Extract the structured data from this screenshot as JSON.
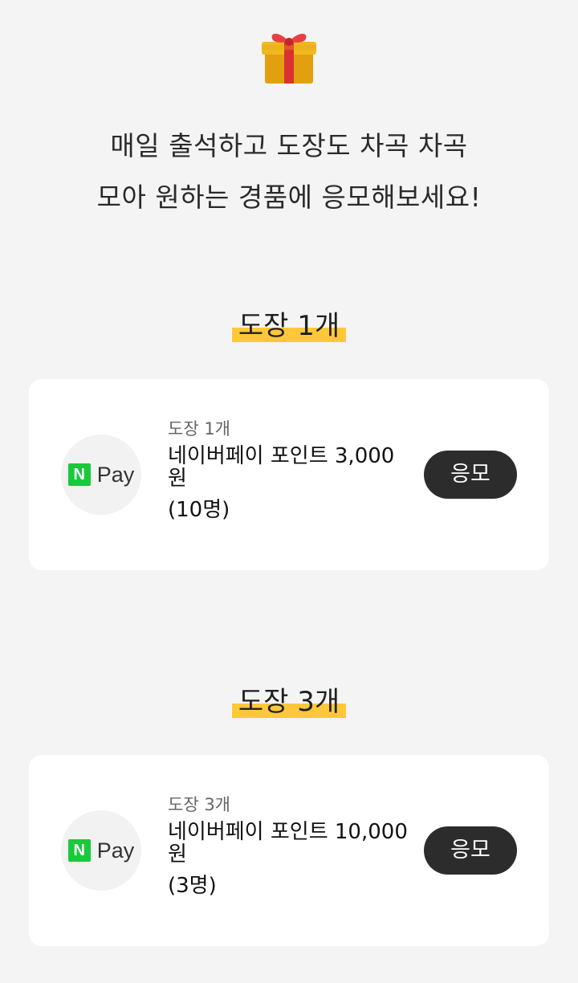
{
  "header": {
    "icon": "gift-icon",
    "line1": "매일 출석하고 도장도 차곡 차곡",
    "line2": "모아 원하는 경품에 응모해보세요!"
  },
  "sections": [
    {
      "title": "도장 1개",
      "reward": {
        "logo": "naver-pay-logo",
        "logo_n": "N",
        "logo_text": "Pay",
        "stamp_label": "도장 1개",
        "name": "네이버페이 포인트 3,000원",
        "winners": "(10명)",
        "button": "응모"
      }
    },
    {
      "title": "도장 3개",
      "reward": {
        "logo": "naver-pay-logo",
        "logo_n": "N",
        "logo_text": "Pay",
        "stamp_label": "도장 3개",
        "name": "네이버페이 포인트 10,000원",
        "winners": "(3명)",
        "button": "응모"
      }
    }
  ],
  "colors": {
    "background": "#f4f4f4",
    "highlight": "#ffc83a",
    "button": "#2c2c2c",
    "naver_green": "#19c93c"
  }
}
